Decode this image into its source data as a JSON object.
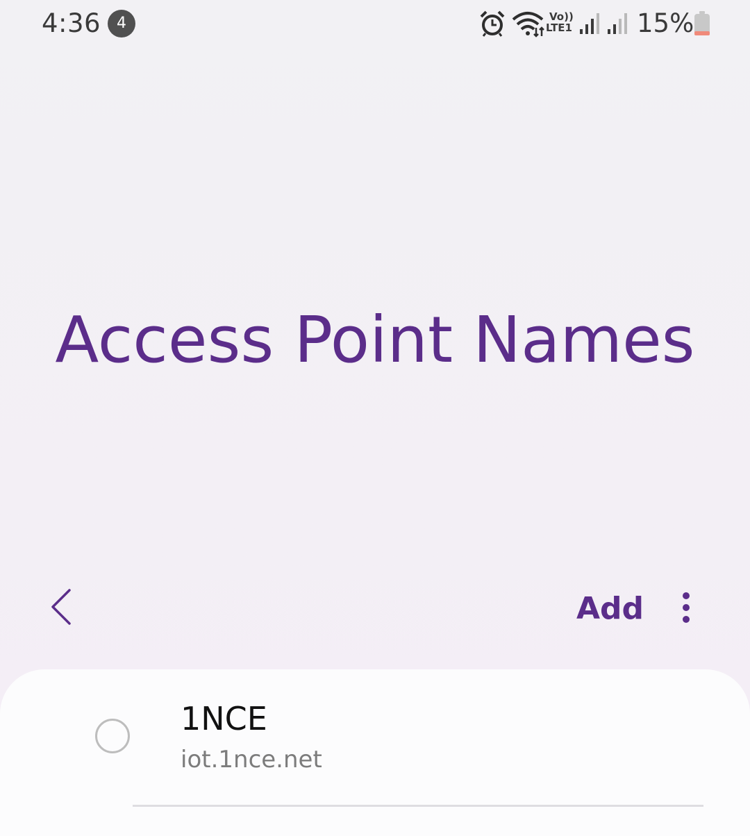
{
  "status_bar": {
    "time": "4:36",
    "notification_count": "4",
    "network_volte_line1": "Vo))",
    "network_volte_line2": "LTE1",
    "battery_percent": "15%",
    "icons": [
      "alarm-icon",
      "wifi-icon",
      "signal-sim1-icon",
      "signal-sim2-icon",
      "battery-icon"
    ],
    "battery_level": 0.15
  },
  "header": {
    "title": "Access Point Names"
  },
  "toolbar": {
    "back_icon": "chevron-left-icon",
    "add_label": "Add",
    "more_icon": "more-vertical-icon"
  },
  "apn_list": [
    {
      "name": "1NCE",
      "apn": "iot.1nce.net",
      "selected": false
    }
  ],
  "colors": {
    "accent": "#5b2d8a",
    "background": "#f3eff5",
    "card": "#fcfcfd",
    "battery_low": "#f08a7a"
  }
}
